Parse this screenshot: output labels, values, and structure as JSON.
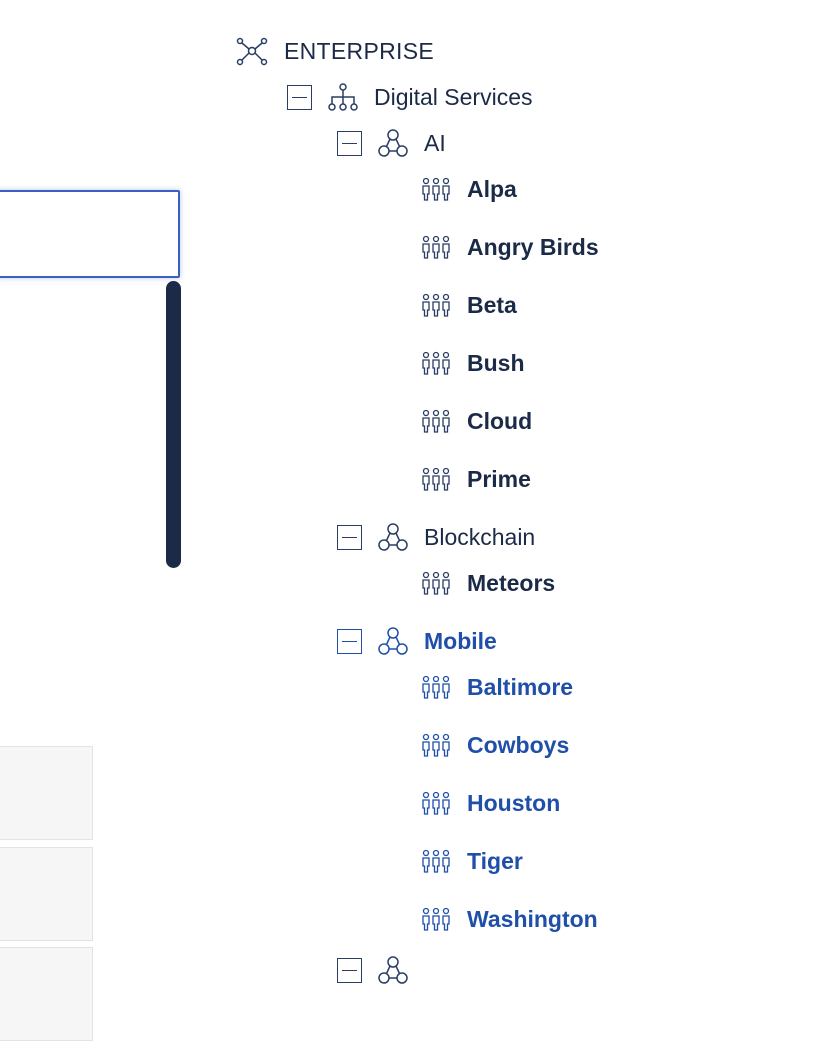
{
  "colors": {
    "text": "#1b2a47",
    "selected": "#1f4fa8",
    "focus_border": "#3a5fc0"
  },
  "tree": {
    "root": {
      "label": "ENTERPRISE",
      "icon": "network-hub-icon"
    },
    "digital_services": {
      "label": "Digital Services",
      "icon": "hierarchy-icon",
      "expanded": true
    },
    "ai": {
      "label": "AI",
      "icon": "group-triad-icon",
      "expanded": true,
      "teams": [
        "Alpa",
        "Angry Birds",
        "Beta",
        "Bush",
        "Cloud",
        "Prime"
      ]
    },
    "blockchain": {
      "label": "Blockchain",
      "icon": "group-triad-icon",
      "expanded": true,
      "teams": [
        "Meteors"
      ]
    },
    "mobile": {
      "label": "Mobile",
      "icon": "group-triad-icon",
      "expanded": true,
      "selected": true,
      "teams": [
        "Baltimore",
        "Cowboys",
        "Houston",
        "Tiger",
        "Washington"
      ]
    }
  }
}
